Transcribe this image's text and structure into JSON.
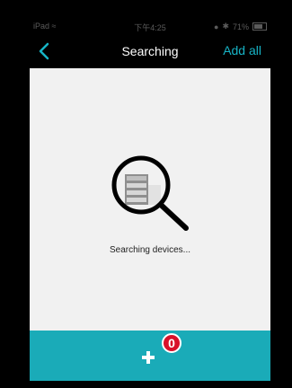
{
  "status_bar": {
    "carrier": "iPad",
    "time": "下午4:25",
    "battery": "71%",
    "battery_level": 0.71
  },
  "nav": {
    "title": "Searching",
    "add_all_label": "Add all"
  },
  "content": {
    "status_text": "Searching devices...",
    "illustration_icon": "magnifier-device-icon"
  },
  "bottom_bar": {
    "icon": "plus-icon",
    "badge_count": "0"
  },
  "colors": {
    "accent": "#1aabb8",
    "link": "#17b4c6",
    "badge": "#d8102a",
    "background": "#f1f1f1"
  }
}
